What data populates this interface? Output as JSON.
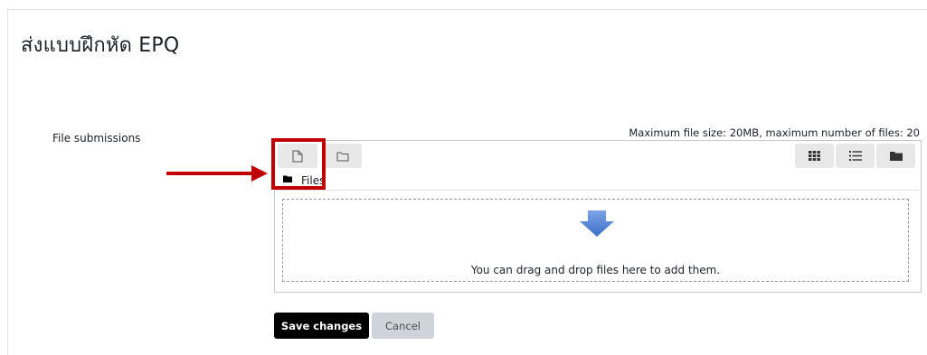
{
  "page": {
    "title": "ส่งแบบฝึกหัด EPQ"
  },
  "form": {
    "field_label": "File submissions",
    "limits_text": "Maximum file size: 20MB, maximum number of files: 20"
  },
  "filepicker": {
    "toolbar": {
      "add_file_icon": "file-icon",
      "create_folder_icon": "folder-outline-icon",
      "view_icons_icon": "grid-icon",
      "view_details_icon": "list-icon",
      "view_tree_icon": "folder-filled-icon"
    },
    "breadcrumb": {
      "folder_label": "Files"
    },
    "dropzone": {
      "text": "You can drag and drop files here to add them."
    }
  },
  "buttons": {
    "save": "Save changes",
    "cancel": "Cancel"
  },
  "annotations": {
    "highlight_color": "#c00000"
  }
}
